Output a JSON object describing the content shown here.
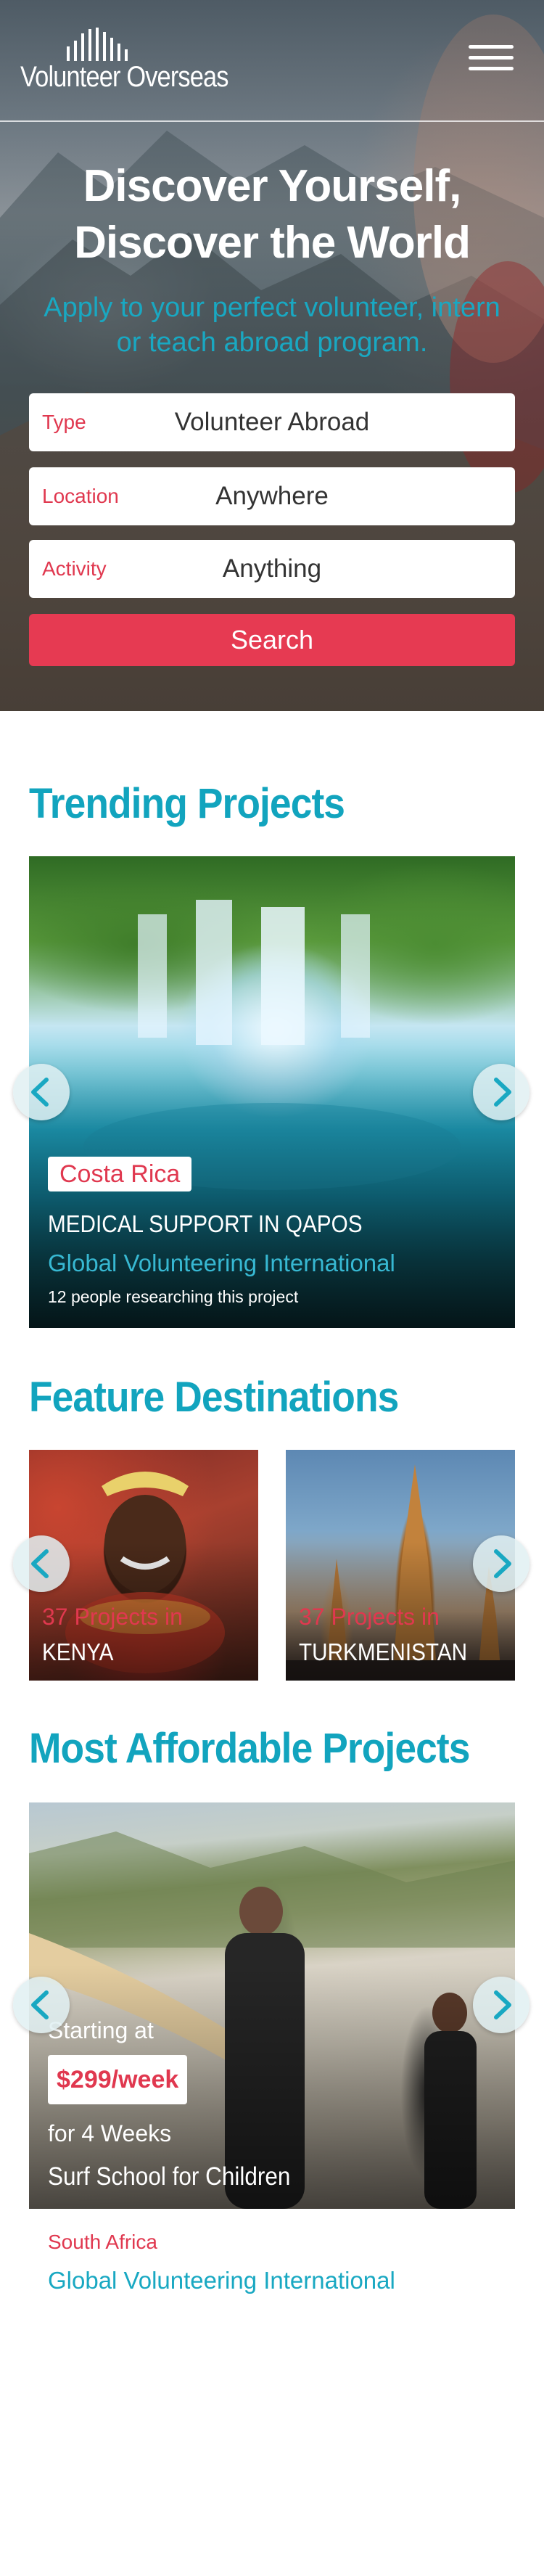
{
  "header": {
    "logo_text": "Volunteer Overseas",
    "menu_icon": "hamburger-menu-icon"
  },
  "hero": {
    "title_line1": "Discover Yourself,",
    "title_line2": "Discover the World",
    "subtitle_line1": "Apply to your perfect volunteer, intern",
    "subtitle_line2": "or teach abroad program.",
    "fields": [
      {
        "label": "Type",
        "value": "Volunteer Abroad"
      },
      {
        "label": "Location",
        "value": "Anywhere"
      },
      {
        "label": "Activity",
        "value": "Anything"
      }
    ],
    "search_label": "Search"
  },
  "trending": {
    "title": "Trending Projects",
    "project": {
      "country": "Costa Rica",
      "name": "MEDICAL SUPPORT IN QAPOS",
      "organization": "Global Volunteering International",
      "researching": "12 people researching this project"
    }
  },
  "destinations": {
    "title": "Feature Destinations",
    "items": [
      {
        "count": "37 Projects in",
        "name": "KENYA"
      },
      {
        "count": "37 Projects in",
        "name": "TURKMENISTAN"
      }
    ]
  },
  "affordable": {
    "title": "Most Affordable Projects",
    "project": {
      "starting": "Starting at",
      "price": "$299/week",
      "duration": "for 4 Weeks",
      "name": "Surf School for Children",
      "country": "South Africa",
      "organization": "Global Volunteering International"
    }
  },
  "colors": {
    "accent_teal": "#12a4be",
    "accent_red": "#e63a52"
  }
}
